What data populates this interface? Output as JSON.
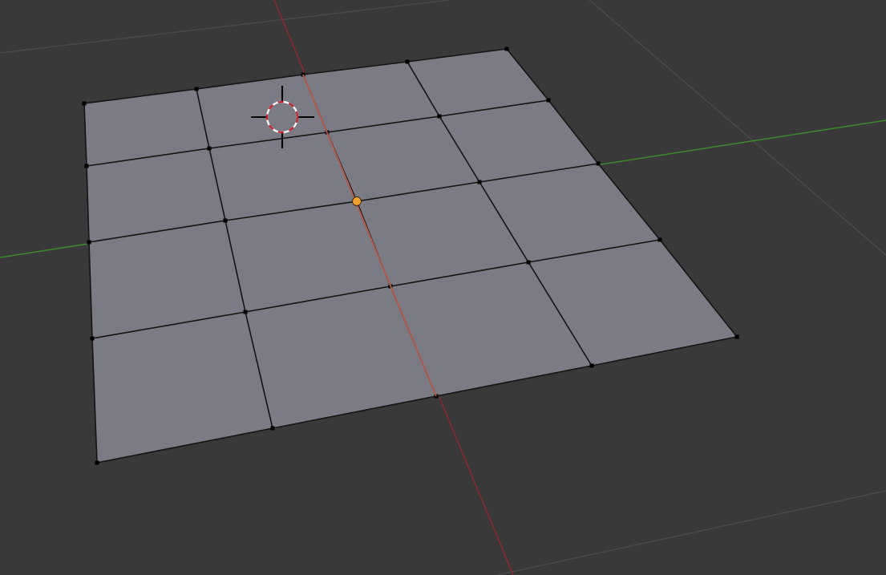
{
  "viewport": {
    "background_color": "#393939",
    "grid_line_color": "#4a4a4a",
    "x_axis_color": "#8b2a2a",
    "y_axis_color": "#3c8a2c"
  },
  "mesh": {
    "object_type": "plane",
    "subdivisions": [
      4,
      4
    ],
    "face_color": "#7b7b86",
    "edge_color": "#141414",
    "vertex_color": "#000000",
    "origin_color": "#f0a030"
  },
  "cursor": {
    "icon": "3d-cursor-icon"
  }
}
